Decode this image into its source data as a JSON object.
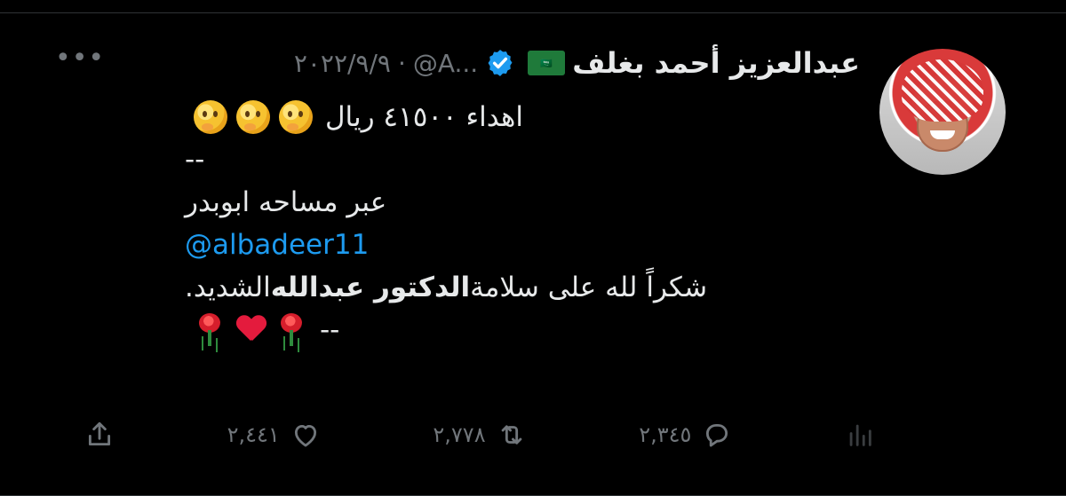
{
  "tweet": {
    "author_name": "عبدالعزيز أحمد بغلف",
    "flag_label": "🇸🇦",
    "handle": "@A...",
    "date": "٢٠٢٢/٩/٩",
    "dot": "·",
    "body_line1": "اهداء ٤١٥٠٠ ريال",
    "body_line2": "--",
    "body_line3": "عبر مساحه ابوبدر",
    "mention": "@albadeer11",
    "body_line5_pre": "شكراً لله على سلامة ",
    "body_line5_bold": "الدكتور عبدالله",
    "body_line5_post": " الشديد.",
    "body_line6": "--",
    "more": "•••",
    "icons": [
      "more-icon",
      "verified-badge-icon",
      "thinking-face-emoji",
      "rose-emoji",
      "red-heart-emoji",
      "analytics-icon",
      "reply-icon",
      "retweet-icon",
      "like-icon",
      "share-icon"
    ]
  },
  "actions": {
    "reply_count": "٢,٣٤٥",
    "retweet_count": "٢,٧٧٨",
    "like_count": "٢,٤٤١"
  },
  "colors": {
    "background": "#000000",
    "text": "#e7e9ea",
    "secondary": "#71767b",
    "link": "#1d9bf0",
    "verified": "#1d9bf0"
  }
}
